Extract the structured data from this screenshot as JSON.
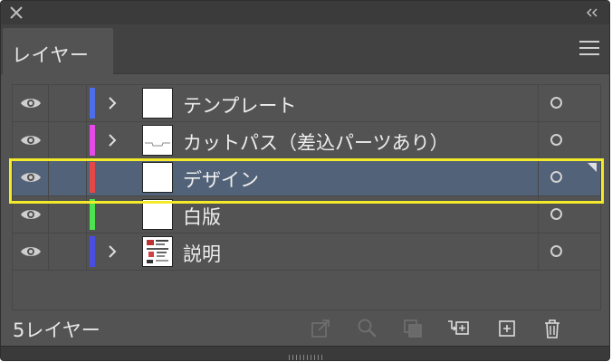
{
  "panel": {
    "tab_label": "レイヤー",
    "footer_label": "5レイヤー"
  },
  "layers": [
    {
      "name": "テンプレート",
      "color": "#4d6ee8",
      "expandable": true,
      "thumb": "blank",
      "selected": false
    },
    {
      "name": "カットパス（差込パーツあり）",
      "color": "#e44ae6",
      "expandable": true,
      "thumb": "cutpath",
      "selected": false
    },
    {
      "name": "デザイン",
      "color": "#e34747",
      "expandable": false,
      "thumb": "blank",
      "selected": true
    },
    {
      "name": "白版",
      "color": "#4ee24e",
      "expandable": false,
      "thumb": "blank",
      "selected": false
    },
    {
      "name": "説明",
      "color": "#4a4ee0",
      "expandable": true,
      "thumb": "doc",
      "selected": false
    }
  ],
  "footer_icons": [
    "export-icon",
    "locate-icon",
    "clipping-mask-icon",
    "create-sublayer-icon",
    "new-layer-icon",
    "trash-icon"
  ],
  "colors": {
    "selection_highlight": "#f2ea2a",
    "selected_row": "#526279"
  }
}
